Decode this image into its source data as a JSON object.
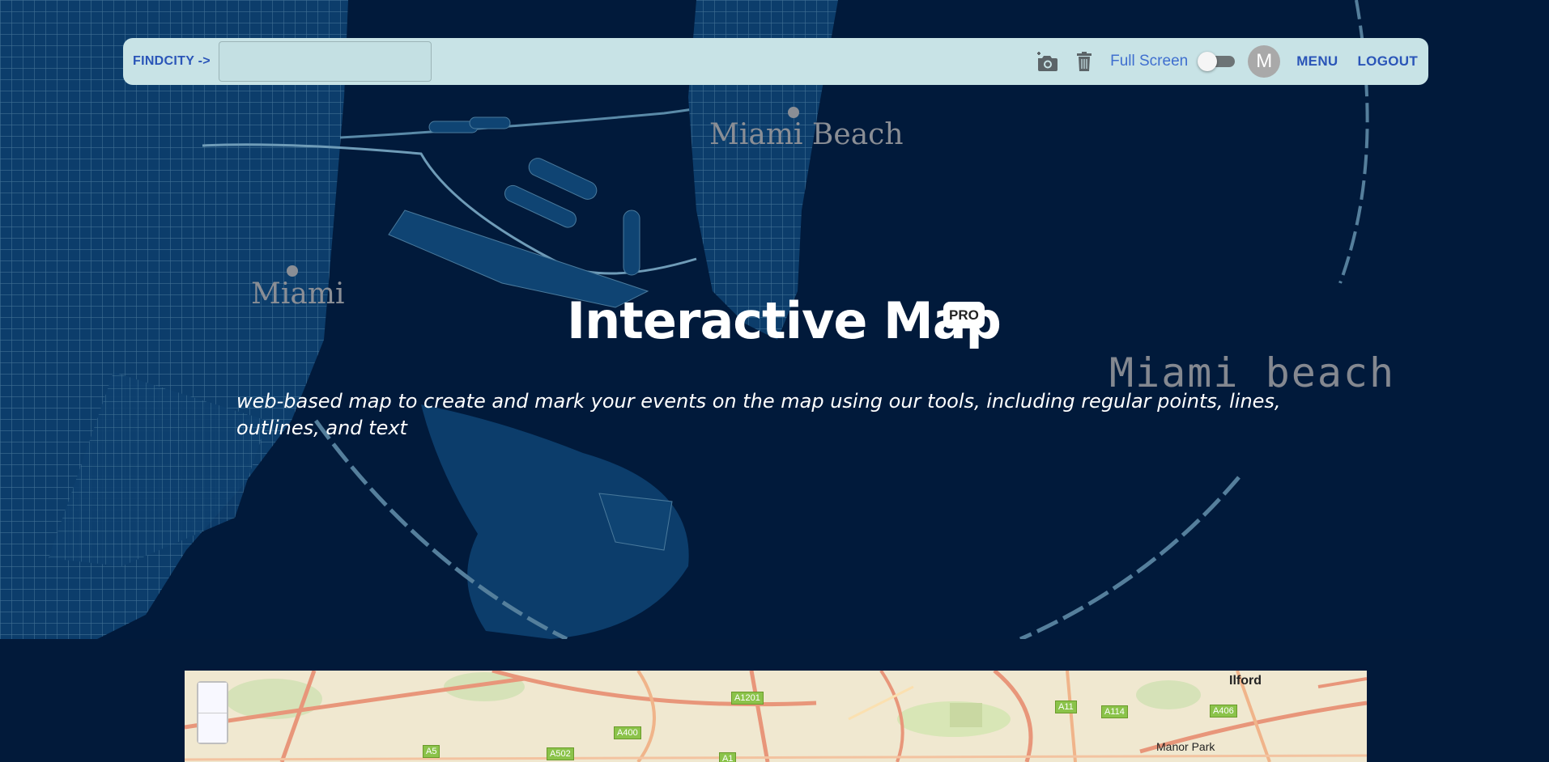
{
  "toolbar": {
    "findcity_label": "FINDCITY ->",
    "city_input_value": "",
    "camera_icon": "add-photo-camera",
    "trash_icon": "delete-bin",
    "fullscreen_label": "Full Screen",
    "fullscreen_on": false,
    "avatar_initial": "M",
    "menu_label": "MENU",
    "logout_label": "LOGOUT"
  },
  "map_labels": {
    "miami_beach": "Miami Beach",
    "miami": "Miami",
    "miami_beach_mono": "Miami beach"
  },
  "hero": {
    "title": "Interactive Map",
    "badge": "PRO",
    "subtitle": "web-based map to create and mark your events on the map using our tools, including regular points, lines, outlines, and text"
  },
  "preview_map": {
    "places": [
      "Ilford",
      "Manor Park"
    ],
    "road_badges": [
      "A1201",
      "A400",
      "A11",
      "A114",
      "A406",
      "A502",
      "A1",
      "A5"
    ],
    "zoom_in_label": "",
    "zoom_out_label": ""
  },
  "colors": {
    "background": "#021a3a",
    "toolbar": "#c8e3e6",
    "link_blue": "#2a55b8"
  }
}
